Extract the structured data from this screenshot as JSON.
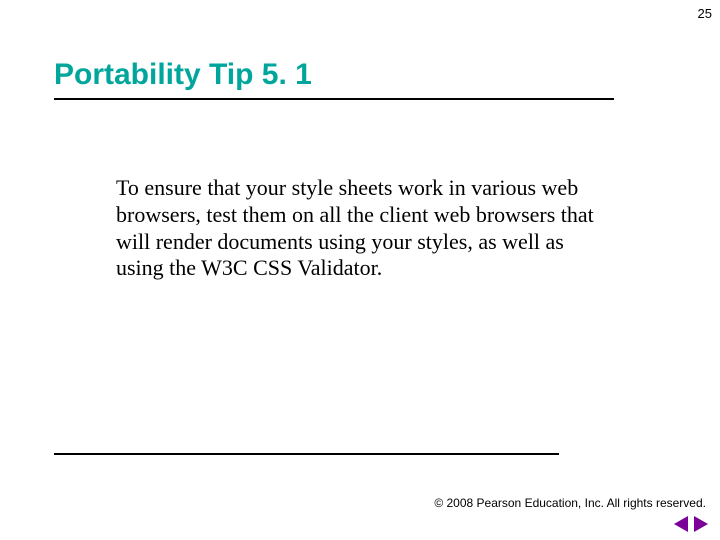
{
  "page_number": "25",
  "title": "Portability Tip 5. 1",
  "body": "To ensure that your style sheets work in various web browsers, test them on all the client web browsers that will render documents using your styles, as well as using the W3C CSS Validator.",
  "footer": "© 2008 Pearson Education, Inc.  All rights reserved.",
  "colors": {
    "accent": "#00a69c",
    "nav": "#7a0099"
  }
}
